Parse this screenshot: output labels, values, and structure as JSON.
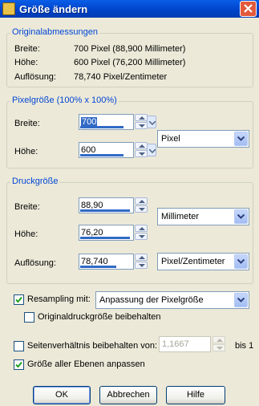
{
  "window": {
    "title": "Größe ändern"
  },
  "original": {
    "legend": "Originalabmessungen",
    "rows": [
      {
        "label": "Breite:",
        "value": "700 Pixel (88,900 Millimeter)"
      },
      {
        "label": "Höhe:",
        "value": "600 Pixel (76,200 Millimeter)"
      },
      {
        "label": "Auflösung:",
        "value": "78,740 Pixel/Zentimeter"
      }
    ]
  },
  "pixel": {
    "legend": "Pixelgröße (100% x 100%)",
    "width_label": "Breite:",
    "width_value": "700",
    "height_label": "Höhe:",
    "height_value": "600",
    "unit": "Pixel"
  },
  "print": {
    "legend": "Druckgröße",
    "width_label": "Breite:",
    "width_value": "88,90",
    "height_label": "Höhe:",
    "height_value": "76,20",
    "unit": "Millimeter",
    "res_label": "Auflösung:",
    "res_value": "78,740",
    "res_unit": "Pixel/Zentimeter"
  },
  "resampling": {
    "label": "Resampling mit:",
    "checked": true,
    "method": "Anpassung der Pixelgröße"
  },
  "keep_print": {
    "label": "Originaldruckgröße beibehalten",
    "checked": false
  },
  "aspect": {
    "label": "Seitenverhältnis beibehalten von:",
    "checked": false,
    "value": "1,1667",
    "suffix": "bis 1"
  },
  "layers": {
    "label": "Größe aller Ebenen anpassen",
    "checked": true
  },
  "buttons": {
    "ok": "OK",
    "cancel": "Abbrechen",
    "help": "Hilfe"
  },
  "colors": {
    "titlebar": "#0a5ee8",
    "legend": "#0046d5",
    "selection": "#316ac5",
    "check": "#21a121"
  },
  "icons": {
    "app": "resize-app-icon",
    "close": "close-icon",
    "check": "checkmark-icon",
    "spin_up": "arrow-up-icon",
    "spin_down": "arrow-down-icon",
    "dropdown": "chevron-down-icon"
  }
}
